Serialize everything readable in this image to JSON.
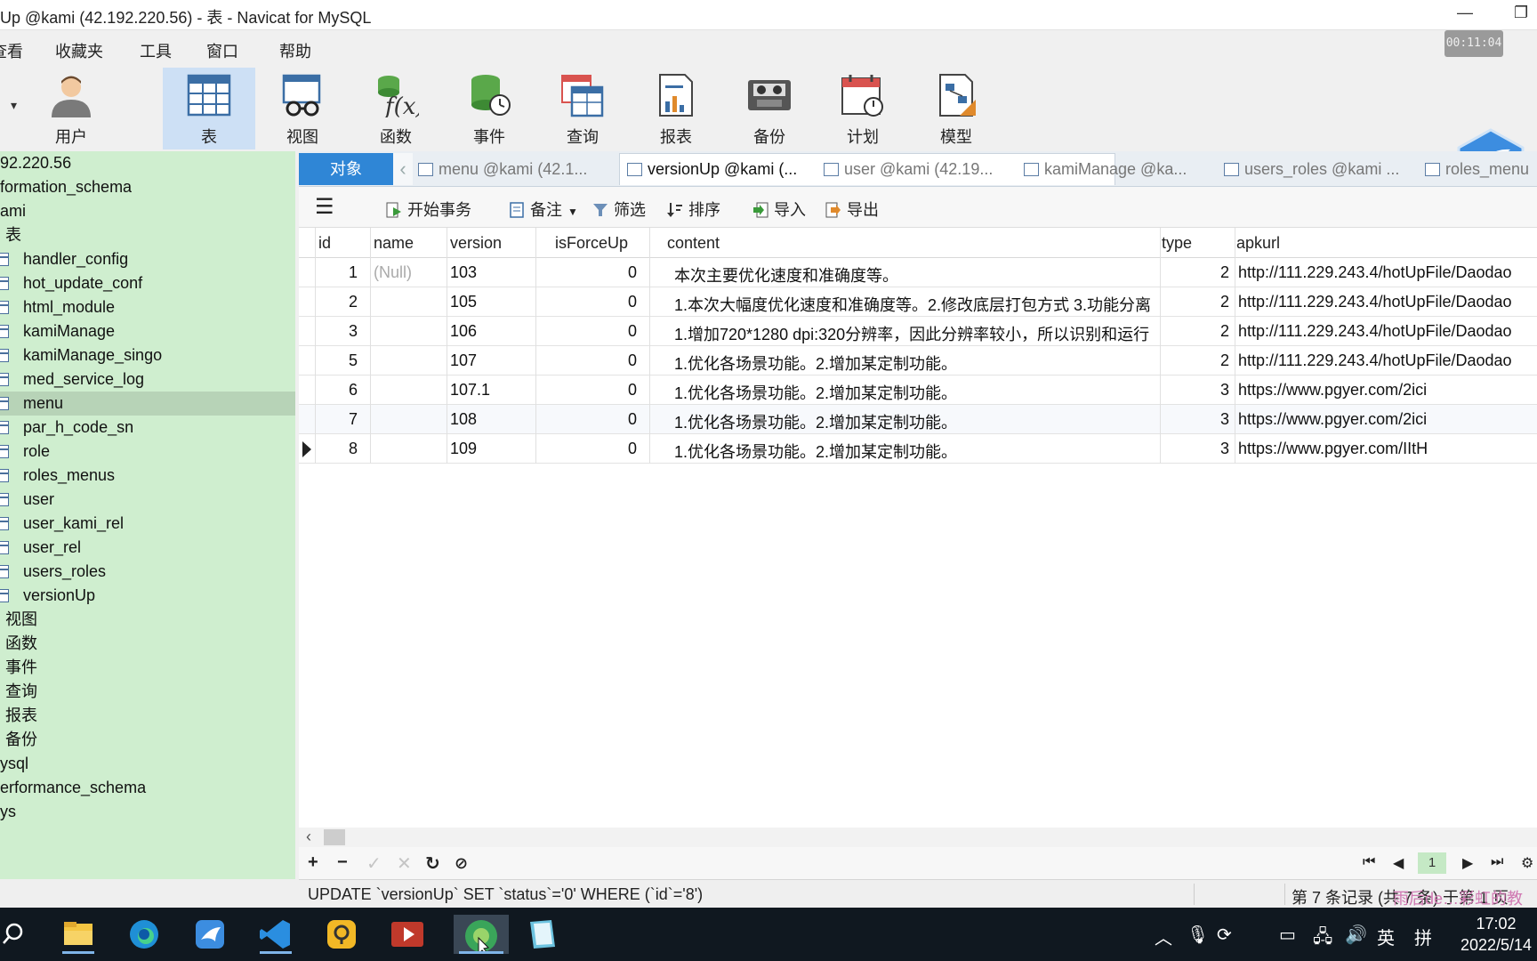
{
  "window": {
    "title": "Up @kami (42.192.220.56) - 表 - Navicat for MySQL",
    "timer": "00:11:04"
  },
  "menu": [
    "查看",
    "收藏夹",
    "工具",
    "窗口",
    "帮助"
  ],
  "toolbar": [
    {
      "label": "用户",
      "icon": "user-icon"
    },
    {
      "label": "表",
      "icon": "table-icon"
    },
    {
      "label": "视图",
      "icon": "view-icon"
    },
    {
      "label": "函数",
      "icon": "function-icon"
    },
    {
      "label": "事件",
      "icon": "event-icon"
    },
    {
      "label": "查询",
      "icon": "query-icon"
    },
    {
      "label": "报表",
      "icon": "report-icon"
    },
    {
      "label": "备份",
      "icon": "backup-icon"
    },
    {
      "label": "计划",
      "icon": "schedule-icon"
    },
    {
      "label": "模型",
      "icon": "model-icon"
    }
  ],
  "sidebar": {
    "items": [
      {
        "label": "92.220.56",
        "kind": "conn"
      },
      {
        "label": "formation_schema",
        "kind": "db"
      },
      {
        "label": "ami",
        "kind": "db"
      },
      {
        "label": "表",
        "kind": "group"
      },
      {
        "label": "handler_config",
        "kind": "table"
      },
      {
        "label": "hot_update_conf",
        "kind": "table"
      },
      {
        "label": "html_module",
        "kind": "table"
      },
      {
        "label": "kamiManage",
        "kind": "table"
      },
      {
        "label": "kamiManage_singo",
        "kind": "table"
      },
      {
        "label": "med_service_log",
        "kind": "table"
      },
      {
        "label": "menu",
        "kind": "table"
      },
      {
        "label": "par_h_code_sn",
        "kind": "table"
      },
      {
        "label": "role",
        "kind": "table"
      },
      {
        "label": "roles_menus",
        "kind": "table"
      },
      {
        "label": "user",
        "kind": "table"
      },
      {
        "label": "user_kami_rel",
        "kind": "table"
      },
      {
        "label": "user_rel",
        "kind": "table"
      },
      {
        "label": "users_roles",
        "kind": "table"
      },
      {
        "label": "versionUp",
        "kind": "table"
      },
      {
        "label": "视图",
        "kind": "group"
      },
      {
        "label": "函数",
        "kind": "group"
      },
      {
        "label": "事件",
        "kind": "group"
      },
      {
        "label": "查询",
        "kind": "group"
      },
      {
        "label": "报表",
        "kind": "group"
      },
      {
        "label": "备份",
        "kind": "group"
      },
      {
        "label": "ysql",
        "kind": "db"
      },
      {
        "label": "erformance_schema",
        "kind": "db"
      },
      {
        "label": "ys",
        "kind": "db"
      }
    ]
  },
  "tabs": [
    {
      "label": "对象"
    },
    {
      "label": "menu @kami (42.1..."
    },
    {
      "label": "versionUp @kami (..."
    },
    {
      "label": "user @kami (42.19..."
    },
    {
      "label": "kamiManage @ka..."
    },
    {
      "label": "users_roles @kami ..."
    },
    {
      "label": "roles_menu"
    }
  ],
  "subtoolbar": {
    "menu_icon": "hamburger-icon",
    "begin_tx": "开始事务",
    "note": "备注",
    "filter": "筛选",
    "sort": "排序",
    "import": "导入",
    "export": "导出"
  },
  "grid": {
    "columns": [
      "id",
      "name",
      "version",
      "isForceUp",
      "content",
      "type",
      "apkurl"
    ],
    "rows": [
      {
        "id": "1",
        "name": "(Null)",
        "version": "103",
        "isForceUp": "0",
        "content": "本次主要优化速度和准确度等。",
        "type": "2",
        "apkurl": "http://111.229.243.4/hotUpFile/Daodao"
      },
      {
        "id": "2",
        "name": "",
        "version": "105",
        "isForceUp": "0",
        "content": "1.本次大幅度优化速度和准确度等。2.修改底层打包方式 3.功能分离",
        "type": "2",
        "apkurl": "http://111.229.243.4/hotUpFile/Daodao"
      },
      {
        "id": "3",
        "name": "",
        "version": "106",
        "isForceUp": "0",
        "content": "1.增加720*1280 dpi:320分辨率，因此分辨率较小，所以识别和运行",
        "type": "2",
        "apkurl": "http://111.229.243.4/hotUpFile/Daodao"
      },
      {
        "id": "5",
        "name": "",
        "version": "107",
        "isForceUp": "0",
        "content": "1.优化各场景功能。2.增加某定制功能。",
        "type": "2",
        "apkurl": "http://111.229.243.4/hotUpFile/Daodao"
      },
      {
        "id": "6",
        "name": "",
        "version": "107.1",
        "isForceUp": "0",
        "content": "1.优化各场景功能。2.增加某定制功能。",
        "type": "3",
        "apkurl": "https://www.pgyer.com/2ici"
      },
      {
        "id": "7",
        "name": "",
        "version": "108",
        "isForceUp": "0",
        "content": "1.优化各场景功能。2.增加某定制功能。",
        "type": "3",
        "apkurl": "https://www.pgyer.com/2ici"
      },
      {
        "id": "8",
        "name": "",
        "version": "109",
        "isForceUp": "0",
        "content": "1.优化各场景功能。2.增加某定制功能。",
        "type": "3",
        "apkurl": "https://www.pgyer.com/IItH"
      }
    ]
  },
  "pagination": {
    "page": "1"
  },
  "status": {
    "sql": "UPDATE `versionUp` SET `status`='0' WHERE (`id`='8')",
    "count": "第 7 条记录 (共 7 条) 于第 1 页",
    "watermark": "雨后de…彩虹的教"
  },
  "taskbar": {
    "apps": [
      "search-icon",
      "file-explorer-icon",
      "edge-icon",
      "feishu-icon",
      "vscode-icon",
      "app-yellow-icon",
      "video-player-icon",
      "navicat-icon",
      "editor-icon"
    ],
    "ime": "英",
    "ime2": "拼",
    "time": "17:02",
    "date": "2022/5/14"
  }
}
